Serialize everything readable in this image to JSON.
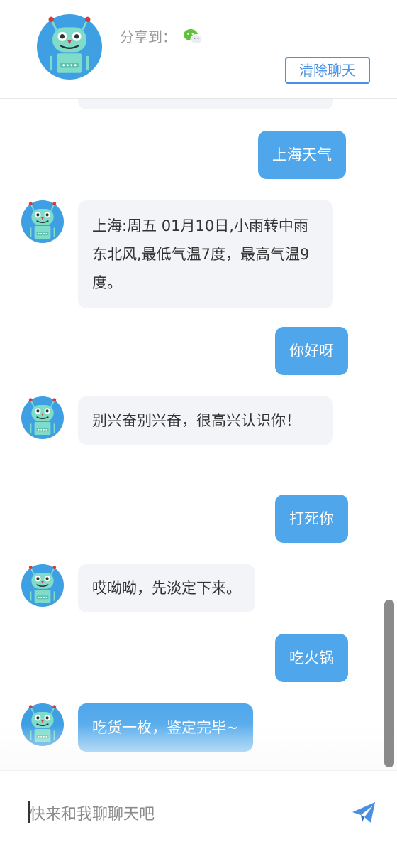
{
  "header": {
    "share_label": "分享到：",
    "share_icon": "wechat-icon",
    "clear_button": "清除聊天"
  },
  "colors": {
    "accent": "#4a90e2",
    "user_bubble": "#4fa6ea",
    "bot_bubble": "#f3f4f7",
    "avatar_bg": "#3f9fe3",
    "robot_body": "#7fdcc8"
  },
  "messages": [
    {
      "from": "bot",
      "text": ""
    },
    {
      "from": "user",
      "text": "上海天气"
    },
    {
      "from": "bot",
      "text": "上海:周五 01月10日,小雨转中雨 东北风,最低气温7度，最高气温9度。"
    },
    {
      "from": "user",
      "text": "你好呀"
    },
    {
      "from": "bot",
      "text": "别兴奋别兴奋，很高兴认识你！"
    },
    {
      "from": "user",
      "text": "打死你"
    },
    {
      "from": "bot",
      "text": "哎呦呦，先淡定下来。"
    },
    {
      "from": "user",
      "text": "吃火锅"
    },
    {
      "from": "bot",
      "text": "吃货一枚，鉴定完毕~"
    }
  ],
  "footer": {
    "input_placeholder": "快来和我聊聊天吧",
    "send_icon": "send-icon"
  }
}
